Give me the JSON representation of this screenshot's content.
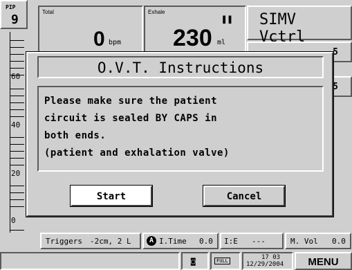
{
  "pip": {
    "label": "PIP",
    "value": "9"
  },
  "total": {
    "label": "Total",
    "value": "0",
    "unit": "bpm"
  },
  "exhale": {
    "label": "Exhale",
    "value": "230",
    "unit": "ml",
    "pause_icon": "pause-icon"
  },
  "mode": {
    "label": "SIMV Vctrl"
  },
  "side_values": [
    "5",
    "5"
  ],
  "scale": {
    "labels": [
      "60",
      "40",
      "20",
      "0"
    ]
  },
  "dialog": {
    "title": "O.V.T. Instructions",
    "message_lines": [
      "Please make sure the patient",
      "circuit is sealed BY CAPS in",
      "both ends.",
      "(patient and exhalation valve)"
    ],
    "start_label": "Start",
    "cancel_label": "Cancel"
  },
  "params": {
    "triggers": {
      "label": "Triggers",
      "value": "-2cm, 2 L"
    },
    "itime": {
      "icon": "lock-icon",
      "icon_text": "A",
      "label": "I.Time",
      "value": "0.0"
    },
    "ie": {
      "label": "I:E",
      "value": "---"
    },
    "mvol": {
      "label": "M. Vol",
      "value": "0.0"
    }
  },
  "status": {
    "camera_icon": "camera-icon",
    "battery_label": "FULL",
    "time": "17 03",
    "date": "12/29/2004",
    "menu_label": "MENU"
  }
}
